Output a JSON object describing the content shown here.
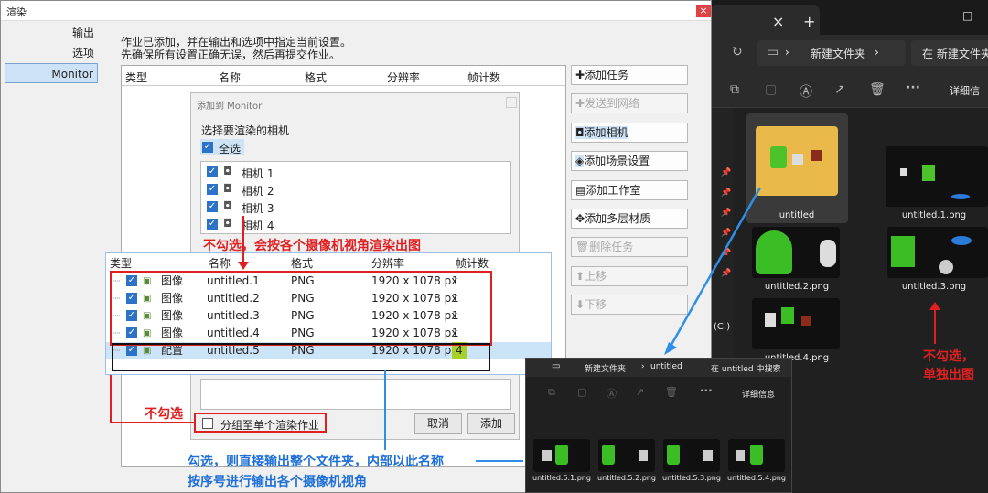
{
  "dialog": {
    "title": "渲染",
    "close": "×",
    "nav": [
      "输出",
      "选项",
      "Monitor"
    ],
    "info_line1": "作业已添加，并在输出和选项中指定当前设置。",
    "info_line2": "先确保所有设置正确无误，然后再提交作业。",
    "columns": [
      "类型",
      "名称",
      "格式",
      "分辨率",
      "帧计数"
    ],
    "side_buttons": [
      "添加任务",
      "发送到网络",
      "添加相机",
      "添加场景设置",
      "添加工作室",
      "添加多层材质",
      "删除任务",
      "上移",
      "下移"
    ]
  },
  "sub_dialog": {
    "title": "添加到 Monitor",
    "prompt": "选择要渲染的相机",
    "select_all": "全选",
    "cameras": [
      "相机 1",
      "相机 2",
      "相机 3",
      "相机 4"
    ],
    "partial_text": "...",
    "group_label": "分组至单个渲染作业",
    "cancel": "取消",
    "add": "添加"
  },
  "job_table": {
    "columns": [
      "类型",
      "名称",
      "格式",
      "分辨率",
      "帧计数"
    ],
    "rows": [
      {
        "type": "图像",
        "name": "untitled.1",
        "format": "PNG",
        "res": "1920 x 1078 px",
        "frames": "1"
      },
      {
        "type": "图像",
        "name": "untitled.2",
        "format": "PNG",
        "res": "1920 x 1078 px",
        "frames": "1"
      },
      {
        "type": "图像",
        "name": "untitled.3",
        "format": "PNG",
        "res": "1920 x 1078 px",
        "frames": "1"
      },
      {
        "type": "图像",
        "name": "untitled.4",
        "format": "PNG",
        "res": "1920 x 1078 px",
        "frames": "1"
      },
      {
        "type": "配置",
        "name": "untitled.5",
        "format": "PNG",
        "res": "1920 x 1078 px",
        "frames": "4"
      }
    ]
  },
  "annotations": {
    "uncheck_cameras": "不勾选，会按各个摄像机视角渲染出图",
    "uncheck": "不勾选",
    "check_line1": "勾选，则直接输出整个文件夹，内部以此名称",
    "check_line2": "按序号进行输出各个摄像机视角",
    "right_line1": "不勾选，",
    "right_line2": "单独出图"
  },
  "explorer": {
    "tab_close": "×",
    "tab_new": "+",
    "minimize": "–",
    "maximize": "□",
    "folder": "新建文件夹",
    "search": "在 新建文件夹",
    "details": "详细信",
    "drive": "(C:)",
    "items": [
      "untitled",
      "untitled.1.png",
      "untitled.2.png",
      "untitled.3.png",
      "untitled.4.png"
    ]
  },
  "explorer2": {
    "folder": "新建文件夹",
    "sub": "untitled",
    "search": "在 untitled 中搜索",
    "details": "详细信息",
    "items": [
      "untitled.5.1.png",
      "untitled.5.2.png",
      "untitled.5.3.png",
      "untitled.5.4.png"
    ]
  }
}
